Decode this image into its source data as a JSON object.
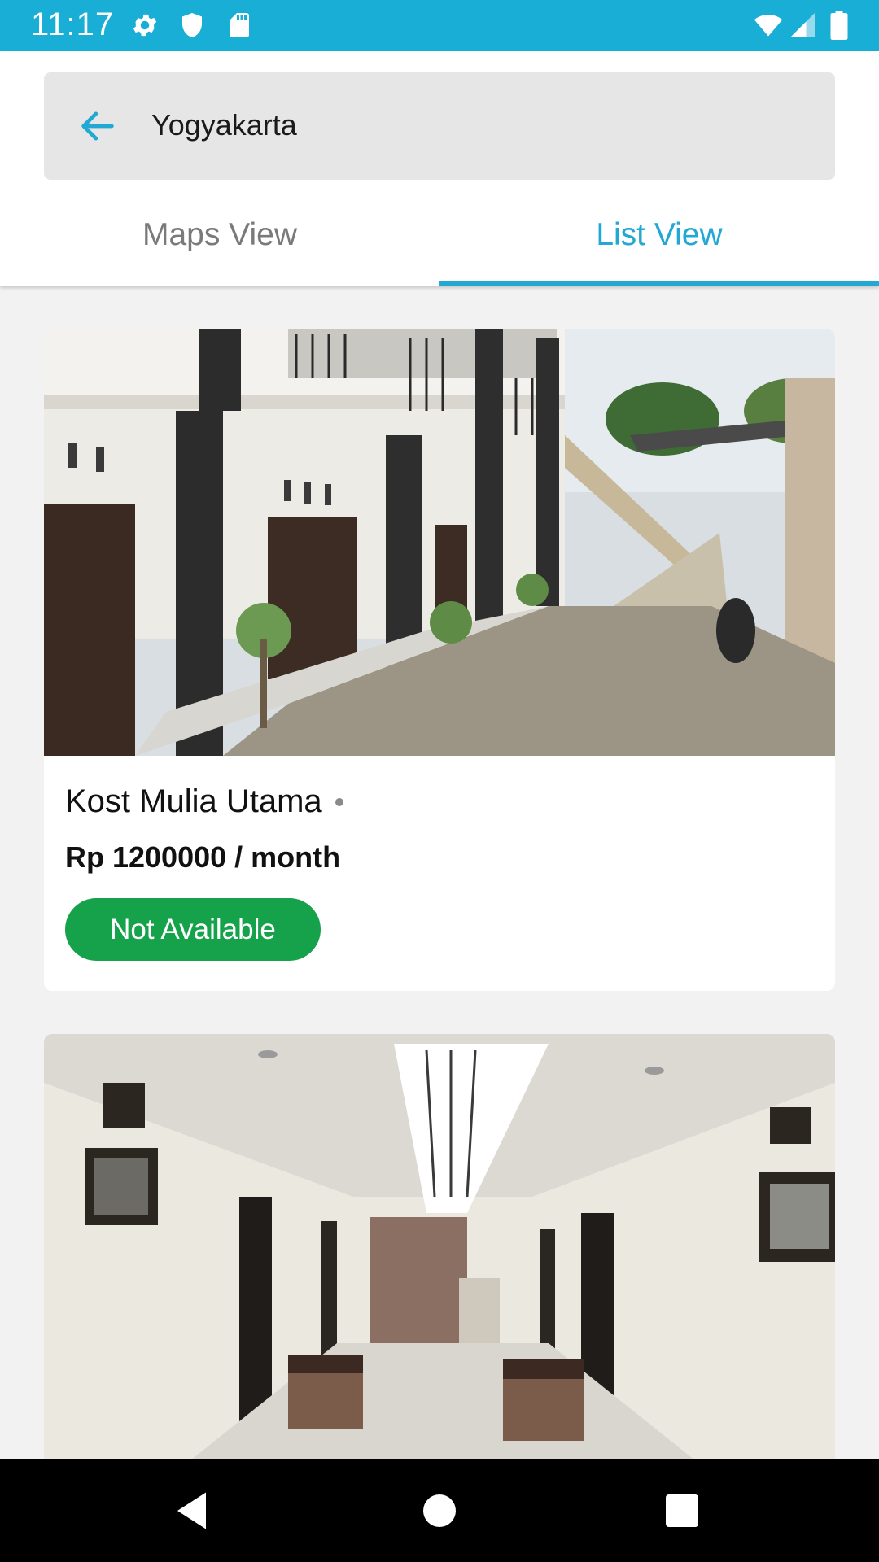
{
  "status_bar": {
    "time": "11:17",
    "background": "#18aed6",
    "icons": [
      "gear-icon",
      "shield-icon",
      "sd-card-icon",
      "wifi-icon",
      "signal-icon",
      "battery-icon"
    ]
  },
  "search": {
    "value": "Yogyakarta",
    "back_icon": "arrow-left-icon"
  },
  "tabs": [
    {
      "label": "Maps View",
      "selected": false
    },
    {
      "label": "List View",
      "selected": true
    }
  ],
  "colors": {
    "accent": "#22a8d2",
    "status_not_available": "#15a24a"
  },
  "listings": [
    {
      "name": "Kost Mulia Utama",
      "price": "Rp 1200000 / month",
      "status": "Not Available",
      "image": "boarding-house-courtyard"
    },
    {
      "image": "boarding-house-hallway"
    }
  ],
  "nav_bar": {
    "buttons": [
      "back-triangle-icon",
      "home-circle-icon",
      "recents-square-icon"
    ]
  }
}
